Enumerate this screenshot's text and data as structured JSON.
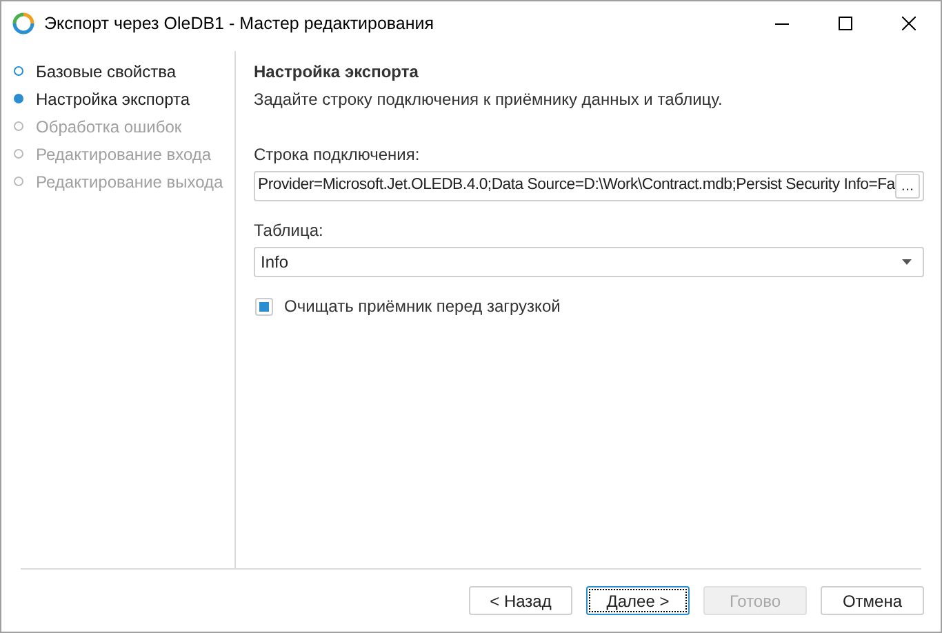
{
  "window": {
    "title": "Экспорт через OleDB1 - Мастер редактирования"
  },
  "steps": [
    {
      "label": "Базовые свойства",
      "selected": false,
      "disabled": false
    },
    {
      "label": "Настройка экспорта",
      "selected": true,
      "disabled": false
    },
    {
      "label": "Обработка ошибок",
      "selected": false,
      "disabled": true
    },
    {
      "label": "Редактирование входа",
      "selected": false,
      "disabled": true
    },
    {
      "label": "Редактирование выхода",
      "selected": false,
      "disabled": true
    }
  ],
  "page": {
    "heading": "Настройка экспорта",
    "description": "Задайте строку подключения к приёмнику данных и таблицу.",
    "connection": {
      "label": "Строка подключения:",
      "value": "Provider=Microsoft.Jet.OLEDB.4.0;Data Source=D:\\Work\\Contract.mdb;Persist Security Info=Fa",
      "browse": "..."
    },
    "table": {
      "label": "Таблица:",
      "value": "Info"
    },
    "clear_target": {
      "label": "Очищать приёмник перед загрузкой",
      "checked": true
    }
  },
  "buttons": [
    {
      "label": "< Назад",
      "disabled": false,
      "focused": false
    },
    {
      "label": "Далее >",
      "disabled": false,
      "focused": true
    },
    {
      "label": "Готово",
      "disabled": true,
      "focused": false
    },
    {
      "label": "Отмена",
      "disabled": false,
      "focused": false
    }
  ]
}
